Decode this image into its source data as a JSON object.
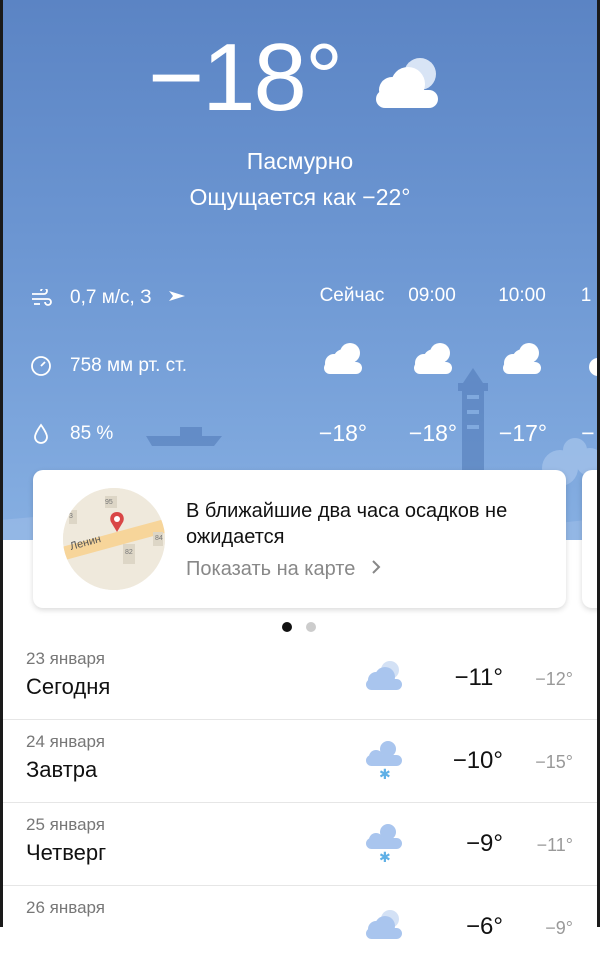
{
  "current": {
    "temperature": "−18°",
    "condition": "Пасмурно",
    "feels_like": "Ощущается как −22°",
    "icon": "cloudy-icon"
  },
  "details": {
    "wind": "0,7 м/с, З",
    "pressure": "758 мм рт. ст.",
    "humidity": "85 %"
  },
  "hourly": [
    {
      "time": "Сейчас",
      "temp": "−18°",
      "icon": "cloudy-icon"
    },
    {
      "time": "09:00",
      "temp": "−18°",
      "icon": "cloudy-icon"
    },
    {
      "time": "10:00",
      "temp": "−17°",
      "icon": "cloudy-icon"
    },
    {
      "time": "1",
      "temp": "−",
      "icon": "cloudy-icon"
    }
  ],
  "nowcast_card": {
    "message": "В ближайшие два часа осадков не ожидается",
    "link": "Показать на карте",
    "map_labels": {
      "street": "Ленин",
      "n95": "95",
      "n82": "82",
      "n84": "84",
      "n3": "3"
    }
  },
  "forecast": [
    {
      "date": "23 января",
      "name": "Сегодня",
      "hi": "−11°",
      "lo": "−12°",
      "icon": "cloudy-icon"
    },
    {
      "date": "24 января",
      "name": "Завтра",
      "hi": "−10°",
      "lo": "−15°",
      "icon": "snow-icon"
    },
    {
      "date": "25 января",
      "name": "Четверг",
      "hi": "−9°",
      "lo": "−11°",
      "icon": "snow-icon"
    },
    {
      "date": "26 января",
      "name": "",
      "hi": "−6°",
      "lo": "−9°",
      "icon": "cloudy-icon"
    }
  ],
  "colors": {
    "sky_top": "#5b84c4",
    "sky_bottom": "#86afe2",
    "cloud": "#ffffff",
    "cloud_light": "#a9c5ee"
  }
}
